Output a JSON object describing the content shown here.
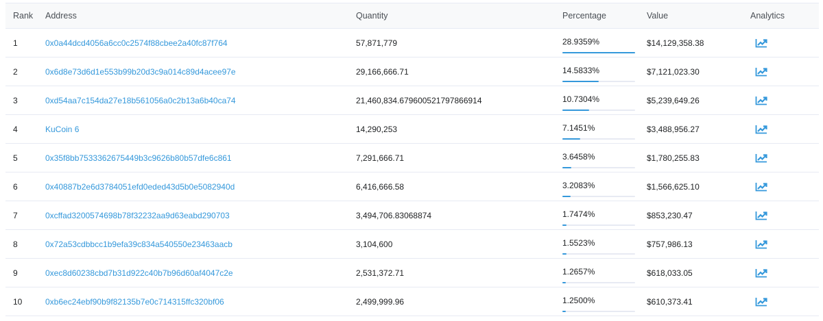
{
  "table": {
    "headers": {
      "rank": "Rank",
      "address": "Address",
      "quantity": "Quantity",
      "percentage": "Percentage",
      "value": "Value",
      "analytics": "Analytics"
    },
    "rows": [
      {
        "rank": "1",
        "address": "0x0a44dcd4056a6cc0c2574f88cbee2a40fc87f764",
        "quantity": "57,871,779",
        "percentage": "28.9359%",
        "pct_value": 28.9359,
        "value": "$14,129,358.38",
        "analytics_icon": "chart-line-icon"
      },
      {
        "rank": "2",
        "address": "0x6d8e73d6d1e553b99b20d3c9a014c89d4acee97e",
        "quantity": "29,166,666.71",
        "percentage": "14.5833%",
        "pct_value": 14.5833,
        "value": "$7,121,023.30",
        "analytics_icon": "chart-line-icon"
      },
      {
        "rank": "3",
        "address": "0xd54aa7c154da27e18b561056a0c2b13a6b40ca74",
        "quantity": "21,460,834.679600521797866914",
        "percentage": "10.7304%",
        "pct_value": 10.7304,
        "value": "$5,239,649.26",
        "analytics_icon": "chart-line-icon"
      },
      {
        "rank": "4",
        "address": "KuCoin 6",
        "quantity": "14,290,253",
        "percentage": "7.1451%",
        "pct_value": 7.1451,
        "value": "$3,488,956.27",
        "analytics_icon": "chart-line-icon"
      },
      {
        "rank": "5",
        "address": "0x35f8bb7533362675449b3c9626b80b57dfe6c861",
        "quantity": "7,291,666.71",
        "percentage": "3.6458%",
        "pct_value": 3.6458,
        "value": "$1,780,255.83",
        "analytics_icon": "chart-line-icon"
      },
      {
        "rank": "6",
        "address": "0x40887b2e6d3784051efd0eded43d5b0e5082940d",
        "quantity": "6,416,666.58",
        "percentage": "3.2083%",
        "pct_value": 3.2083,
        "value": "$1,566,625.10",
        "analytics_icon": "chart-line-icon"
      },
      {
        "rank": "7",
        "address": "0xcffad3200574698b78f32232aa9d63eabd290703",
        "quantity": "3,494,706.83068874",
        "percentage": "1.7474%",
        "pct_value": 1.7474,
        "value": "$853,230.47",
        "analytics_icon": "chart-line-icon"
      },
      {
        "rank": "8",
        "address": "0x72a53cdbbcc1b9efa39c834a540550e23463aacb",
        "quantity": "3,104,600",
        "percentage": "1.5523%",
        "pct_value": 1.5523,
        "value": "$757,986.13",
        "analytics_icon": "chart-line-icon"
      },
      {
        "rank": "9",
        "address": "0xec8d60238cbd7b31d922c40b7b96d60af4047c2e",
        "quantity": "2,531,372.71",
        "percentage": "1.2657%",
        "pct_value": 1.2657,
        "value": "$618,033.05",
        "analytics_icon": "chart-line-icon"
      },
      {
        "rank": "10",
        "address": "0xb6ec24ebf90b9f82135b7e0c714315ffc320bf06",
        "quantity": "2,499,999.96",
        "percentage": "1.2500%",
        "pct_value": 1.25,
        "value": "$610,373.41",
        "analytics_icon": "chart-line-icon"
      }
    ]
  },
  "colors": {
    "link": "#3498db",
    "bar_fill": "#3498db",
    "bar_track": "#e7eaf3",
    "header_bg": "#f8f9fa",
    "border": "#e7eaf3"
  }
}
